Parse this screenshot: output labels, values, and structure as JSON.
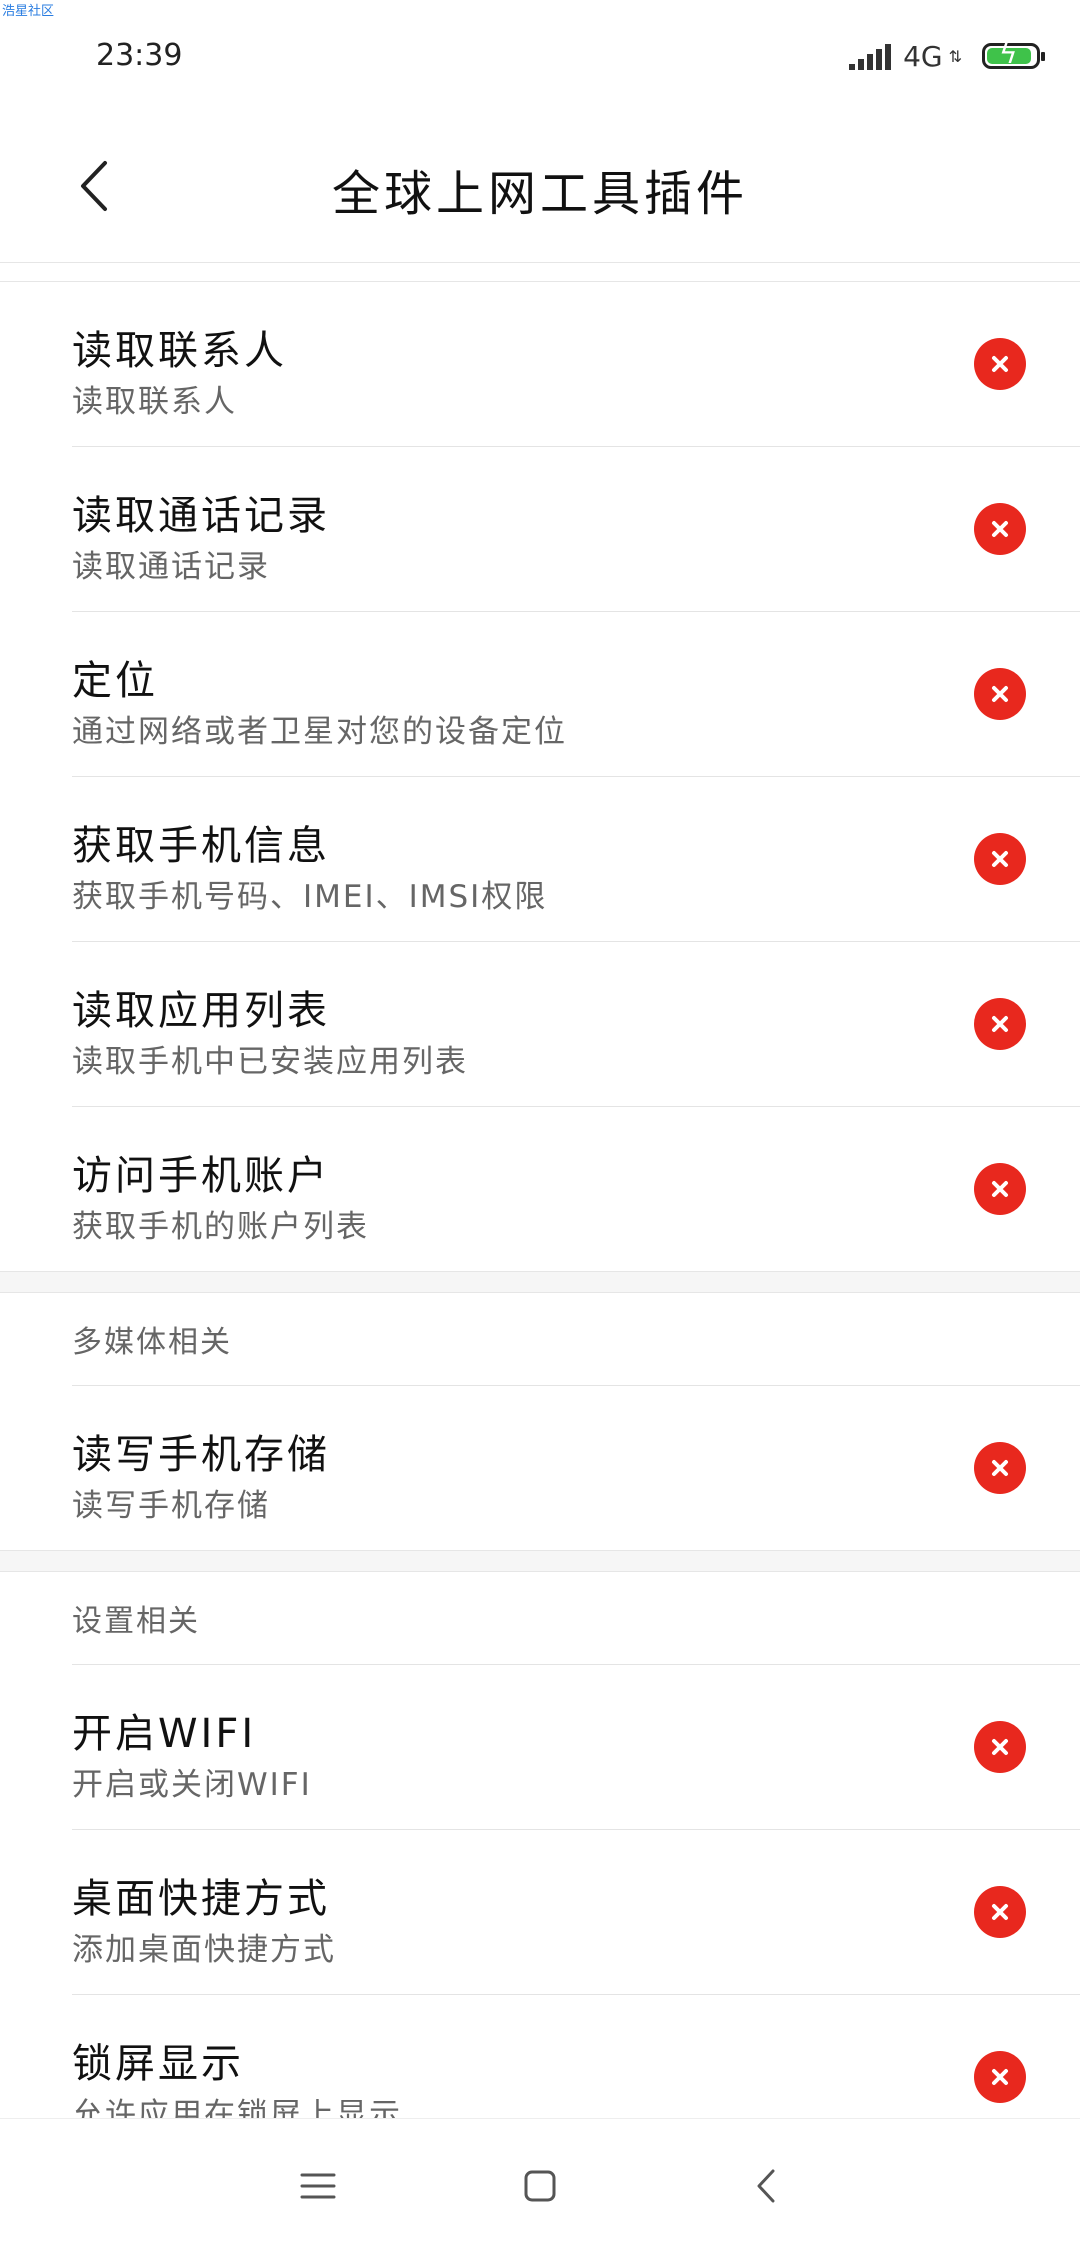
{
  "watermark": "浩星社区",
  "status_bar": {
    "time": "23:39",
    "network": "4G",
    "signal_icon": "signal-bars-icon",
    "battery_icon": "battery-charging-icon",
    "battery_color": "#3fc24a"
  },
  "header": {
    "title": "全球上网工具插件",
    "back_icon": "chevron-left-icon"
  },
  "colors": {
    "denied": "#e8281e",
    "section_label": "#666666",
    "divider": "#e4e4e4"
  },
  "groups": [
    {
      "label": "",
      "items": [
        {
          "title": "读取联系人",
          "desc": "读取联系人",
          "status_icon": "denied-x-icon"
        },
        {
          "title": "读取通话记录",
          "desc": "读取通话记录",
          "status_icon": "denied-x-icon"
        },
        {
          "title": "定位",
          "desc": "通过网络或者卫星对您的设备定位",
          "status_icon": "denied-x-icon"
        },
        {
          "title": "获取手机信息",
          "desc": "获取手机号码、IMEI、IMSI权限",
          "status_icon": "denied-x-icon"
        },
        {
          "title": "读取应用列表",
          "desc": "读取手机中已安装应用列表",
          "status_icon": "denied-x-icon"
        },
        {
          "title": "访问手机账户",
          "desc": "获取手机的账户列表",
          "status_icon": "denied-x-icon"
        }
      ]
    },
    {
      "label": "多媒体相关",
      "items": [
        {
          "title": "读写手机存储",
          "desc": "读写手机存储",
          "status_icon": "denied-x-icon"
        }
      ]
    },
    {
      "label": "设置相关",
      "items": [
        {
          "title": "开启WIFI",
          "desc": "开启或关闭WIFI",
          "status_icon": "denied-x-icon"
        },
        {
          "title": "桌面快捷方式",
          "desc": "添加桌面快捷方式",
          "status_icon": "denied-x-icon"
        },
        {
          "title": "锁屏显示",
          "desc": "允许应用在锁屏上显示",
          "status_icon": "denied-x-icon"
        }
      ]
    }
  ],
  "nav_bar": {
    "menu_icon": "menu-lines-icon",
    "home_icon": "home-square-icon",
    "back_icon": "back-triangle-icon"
  }
}
